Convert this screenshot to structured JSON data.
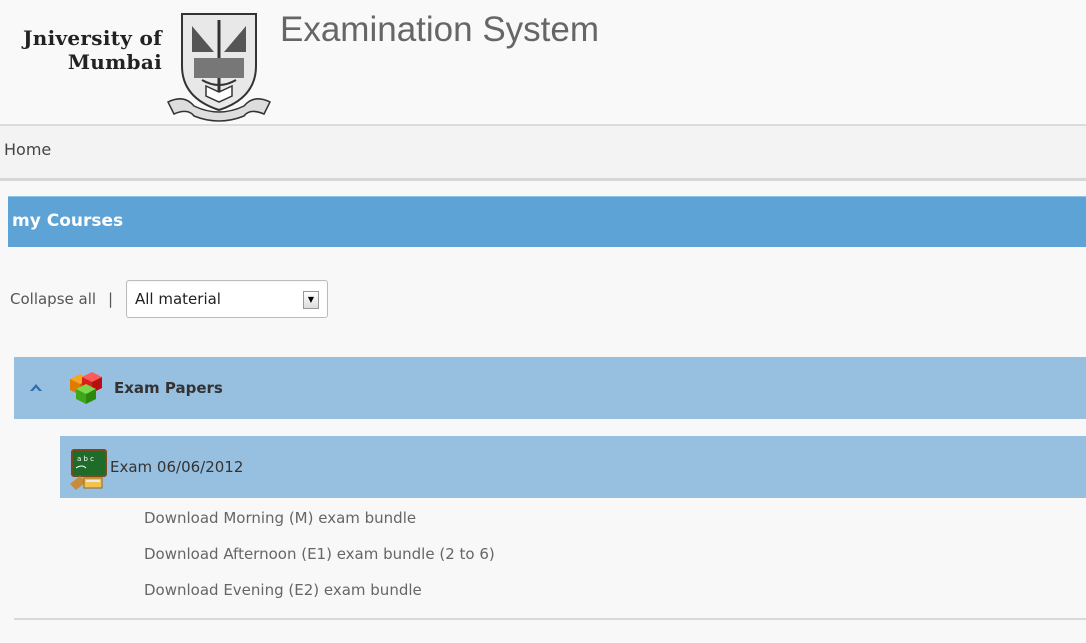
{
  "header": {
    "logo_line1": "Jniversity of",
    "logo_line2": "Mumbai",
    "title": "Examination System"
  },
  "nav": {
    "home_label": "Home"
  },
  "banner": {
    "title": "my Courses"
  },
  "filter": {
    "collapse_all_label": "Collapse all",
    "separator": "|",
    "select_value": "All material"
  },
  "section": {
    "title": "Exam Papers"
  },
  "exam": {
    "title": "Exam 06/06/2012",
    "links": [
      "Download Morning (M) exam bundle",
      "Download Afternoon (E1) exam bundle (2 to 6)",
      "Download Evening (E2) exam bundle"
    ]
  },
  "colors": {
    "banner_blue": "#5ea3d5",
    "section_blue": "#96bfe0",
    "link_gray": "#666666"
  },
  "icons": {
    "section_toggle": "chevron-up-icon",
    "section_icon": "colored-cubes-icon",
    "exam_icon": "blackboard-icon"
  }
}
